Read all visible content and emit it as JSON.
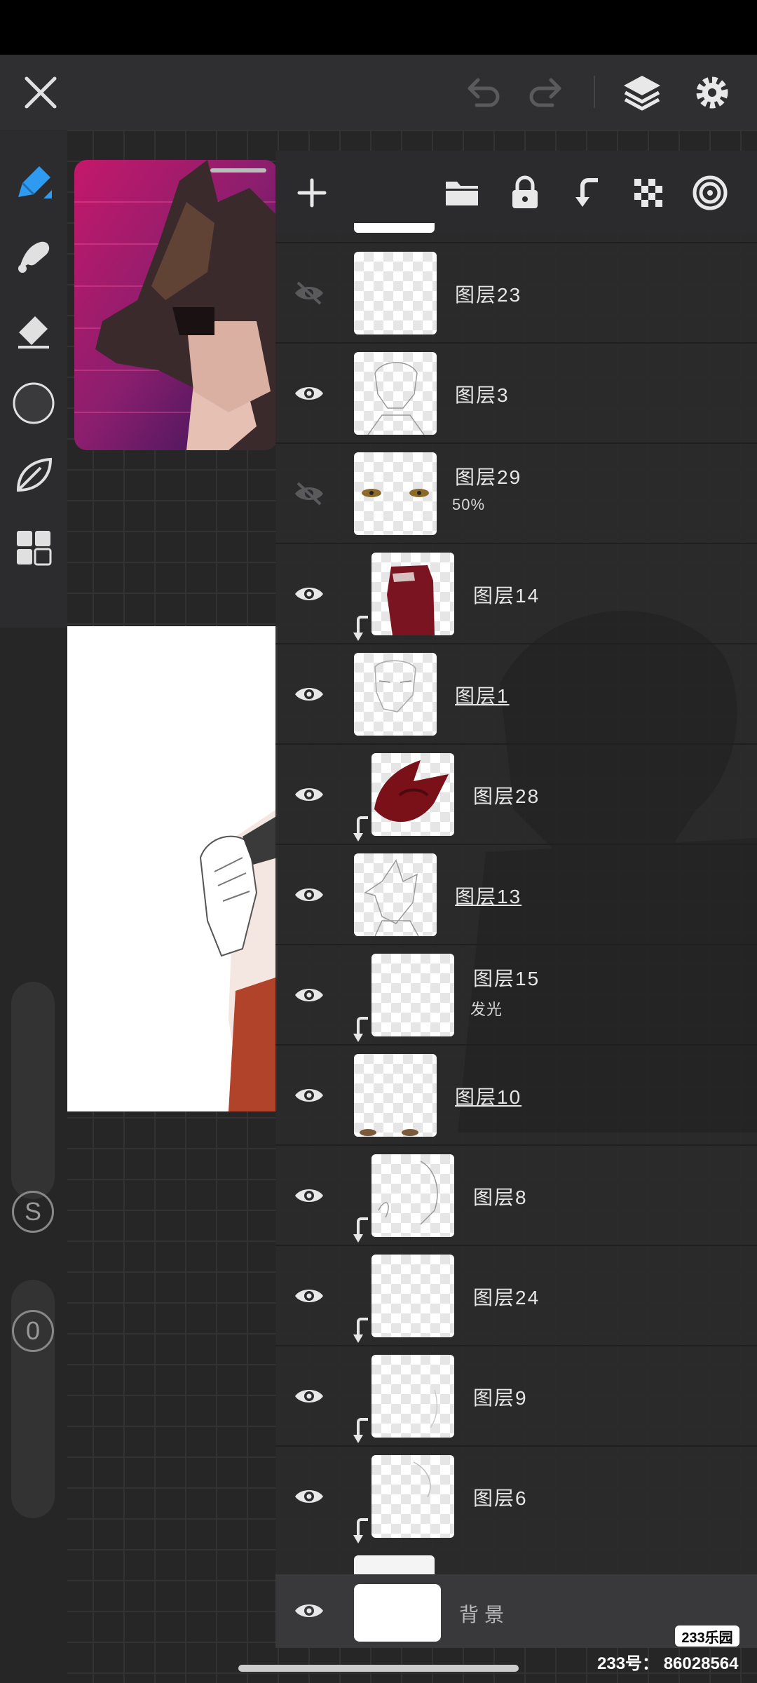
{
  "toolbar": {
    "icons": [
      "close-icon",
      "undo-icon",
      "redo-icon",
      "layers-icon",
      "settings-icon"
    ]
  },
  "tools": [
    "brush-icon",
    "smudge-icon",
    "eraser-icon",
    "color-swatch",
    "leaf-icon",
    "grid-icon"
  ],
  "side_buttons": {
    "size_label": "S",
    "opacity_label": "0"
  },
  "layer_toolbar": {
    "icons": [
      "add-layer-icon",
      "folder-icon",
      "lock-icon",
      "clip-arrow-icon",
      "checkerboard-icon",
      "target-icon"
    ]
  },
  "layers": [
    {
      "name": "图层23",
      "visible": false,
      "clipped": false,
      "underline": false,
      "sub": ""
    },
    {
      "name": "图层3",
      "visible": true,
      "clipped": false,
      "underline": false,
      "sub": ""
    },
    {
      "name": "图层29",
      "visible": false,
      "clipped": false,
      "underline": false,
      "sub": "50%"
    },
    {
      "name": "图层14",
      "visible": true,
      "clipped": true,
      "underline": false,
      "sub": ""
    },
    {
      "name": "图层1",
      "visible": true,
      "clipped": false,
      "underline": true,
      "sub": ""
    },
    {
      "name": "图层28",
      "visible": true,
      "clipped": true,
      "underline": false,
      "sub": ""
    },
    {
      "name": "图层13",
      "visible": true,
      "clipped": false,
      "underline": true,
      "sub": ""
    },
    {
      "name": "图层15",
      "visible": true,
      "clipped": true,
      "underline": false,
      "sub": "发光"
    },
    {
      "name": "图层10",
      "visible": true,
      "clipped": false,
      "underline": true,
      "sub": ""
    },
    {
      "name": "图层8",
      "visible": true,
      "clipped": true,
      "underline": false,
      "sub": ""
    },
    {
      "name": "图层24",
      "visible": true,
      "clipped": true,
      "underline": false,
      "sub": ""
    },
    {
      "name": "图层9",
      "visible": true,
      "clipped": true,
      "underline": false,
      "sub": ""
    },
    {
      "name": "图层6",
      "visible": true,
      "clipped": true,
      "underline": false,
      "sub": ""
    }
  ],
  "background_layer": {
    "name": "背景"
  },
  "watermark": {
    "logo": "233乐园",
    "id": "233号： 86028564"
  },
  "colors": {
    "accent": "#2e9bf0",
    "panel": "#2b2a2c",
    "topbar": "#2f2f31"
  }
}
